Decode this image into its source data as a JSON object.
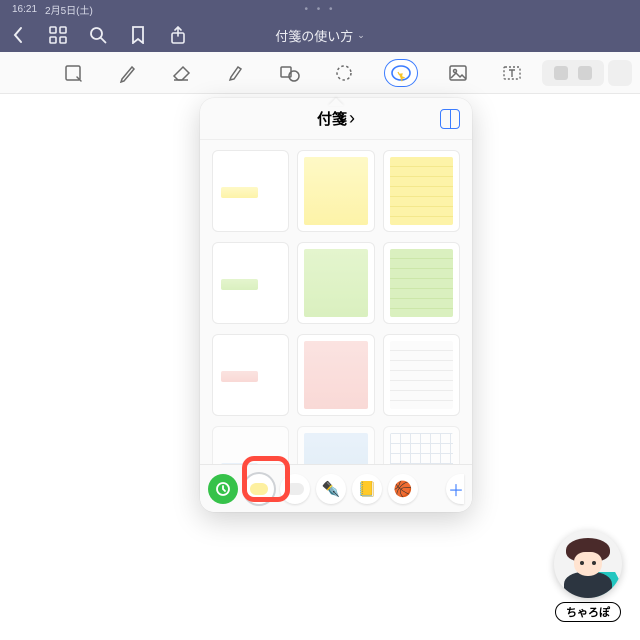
{
  "status": {
    "time": "16:21",
    "date": "2月5日(土)"
  },
  "nav": {
    "title": "付箋の使い方",
    "chev": "⌄"
  },
  "toolbar": {
    "items": [
      "readmode",
      "pen",
      "eraser",
      "highlighter",
      "shapes",
      "lasso",
      "stickers",
      "image",
      "text",
      "magic"
    ],
    "active": "stickers"
  },
  "popover": {
    "title": "付箋",
    "chev": "›",
    "rows": [
      [
        {
          "style": "bar",
          "cls": "y-full"
        },
        {
          "style": "full",
          "cls": "y-full"
        },
        {
          "style": "full",
          "cls": "y-lines"
        }
      ],
      [
        {
          "style": "bar",
          "cls": "g-full"
        },
        {
          "style": "full",
          "cls": "g-full"
        },
        {
          "style": "full",
          "cls": "g-lines"
        }
      ],
      [
        {
          "style": "bar",
          "cls": "p-full"
        },
        {
          "style": "full",
          "cls": "p-full"
        },
        {
          "style": "full",
          "cls": "p-lines"
        }
      ],
      [
        {
          "style": "bar",
          "cls": "b-full"
        },
        {
          "style": "full",
          "cls": "b-full"
        },
        {
          "style": "full",
          "cls": "b-grid"
        }
      ]
    ],
    "toolbar": {
      "circles": [
        {
          "kind": "history",
          "bg": "green",
          "icon": "clock"
        },
        {
          "kind": "sticky-yellow",
          "swatch": "#fdf0a0",
          "selected": true
        },
        {
          "kind": "sticky-gray",
          "swatch": "#ededed"
        },
        {
          "kind": "pen-brush",
          "emoji": "✒️"
        },
        {
          "kind": "notes",
          "emoji": "📒"
        },
        {
          "kind": "ball",
          "emoji": "🏀"
        }
      ],
      "plus": "＋"
    },
    "highlight_index": 1
  },
  "signature": {
    "name": "ちゃろぽ"
  }
}
